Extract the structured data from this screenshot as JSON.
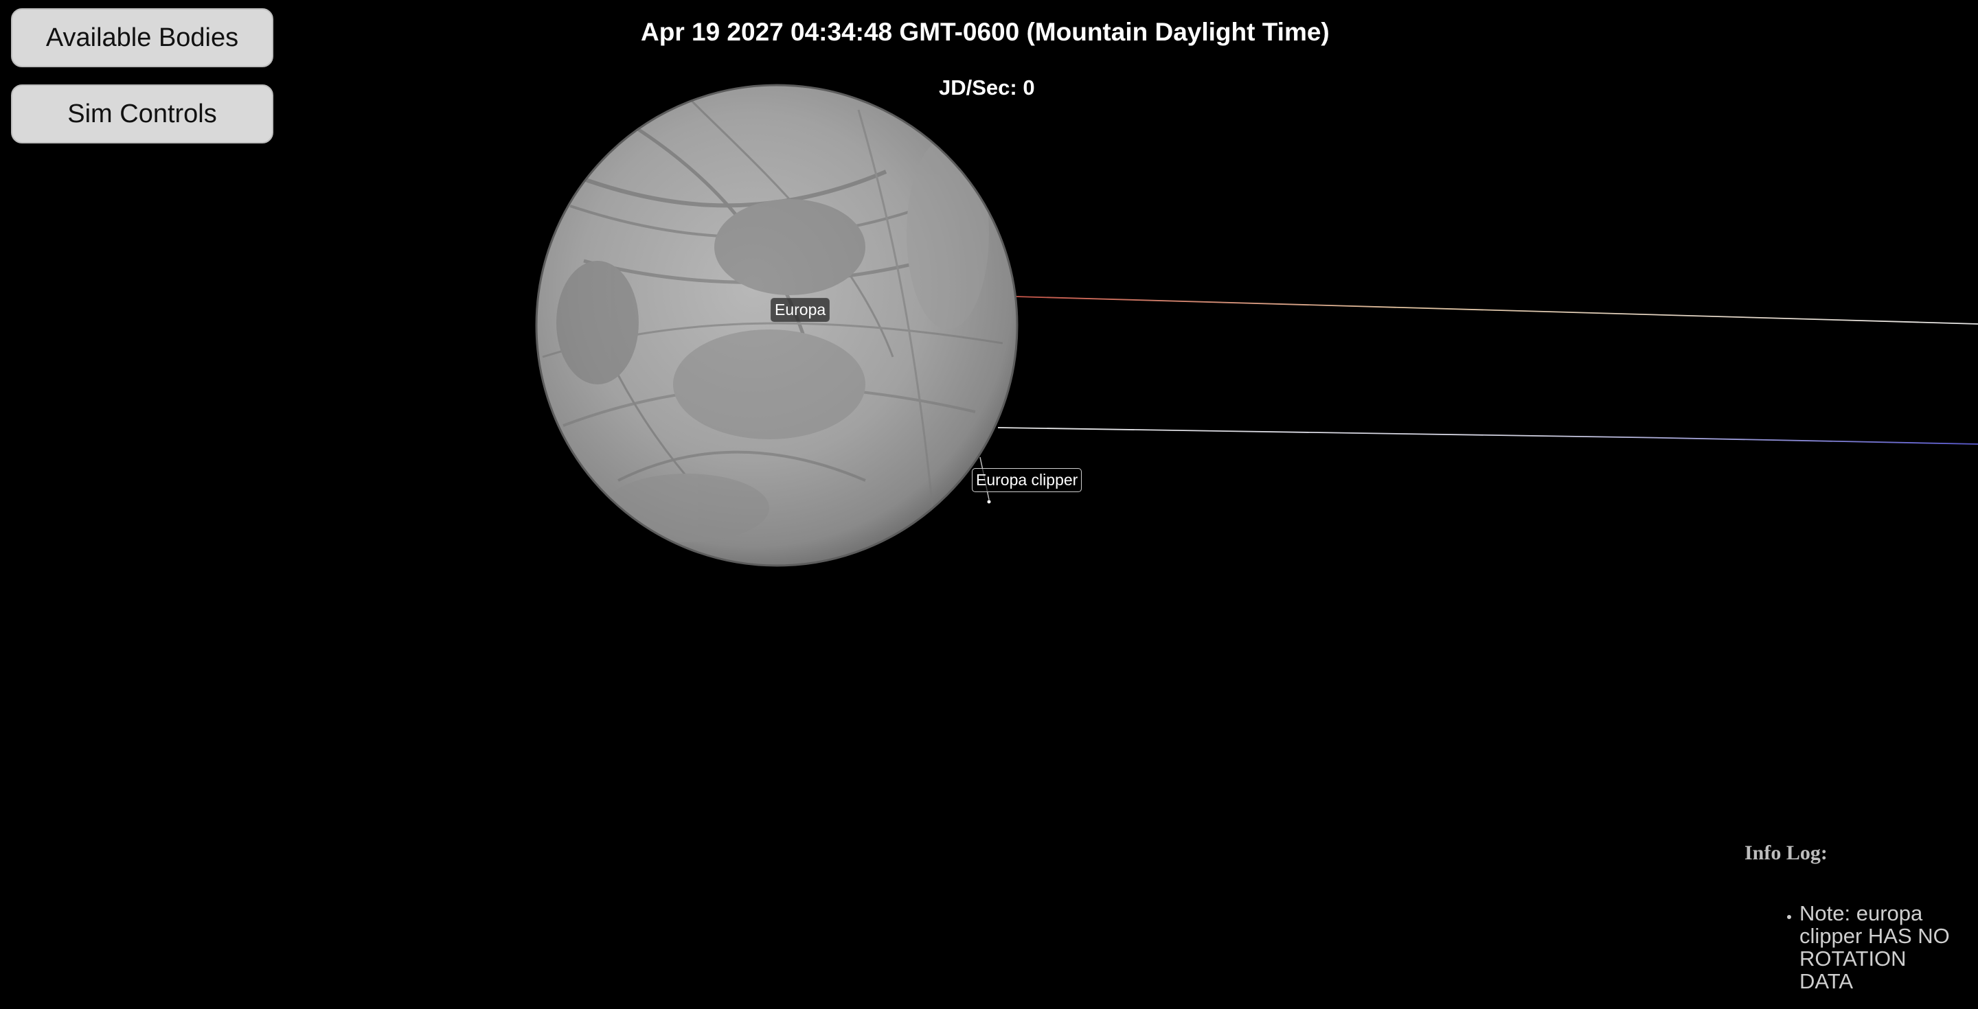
{
  "sidebar": {
    "available_bodies_label": "Available Bodies",
    "sim_controls_label": "Sim Controls"
  },
  "header": {
    "datetime": "Apr 19 2027 04:34:48 GMT-0600 (Mountain Daylight Time)",
    "jd_per_sec": "JD/Sec: 0"
  },
  "scene": {
    "bodies": [
      {
        "name": "Europa",
        "icon": "planet-sphere"
      },
      {
        "name": "Europa clipper",
        "icon": "spacecraft-marker"
      }
    ],
    "colors": {
      "background": "#000000",
      "orbit_line_red": "#c9564a",
      "orbit_line_white": "#e8e8e8",
      "orbit_line_blue": "#5a5ad0",
      "moon_surface": "#a9a9a9"
    }
  },
  "info_log": {
    "title": "Info Log:",
    "entries": [
      "Note: europa clipper HAS NO ROTATION DATA"
    ]
  }
}
